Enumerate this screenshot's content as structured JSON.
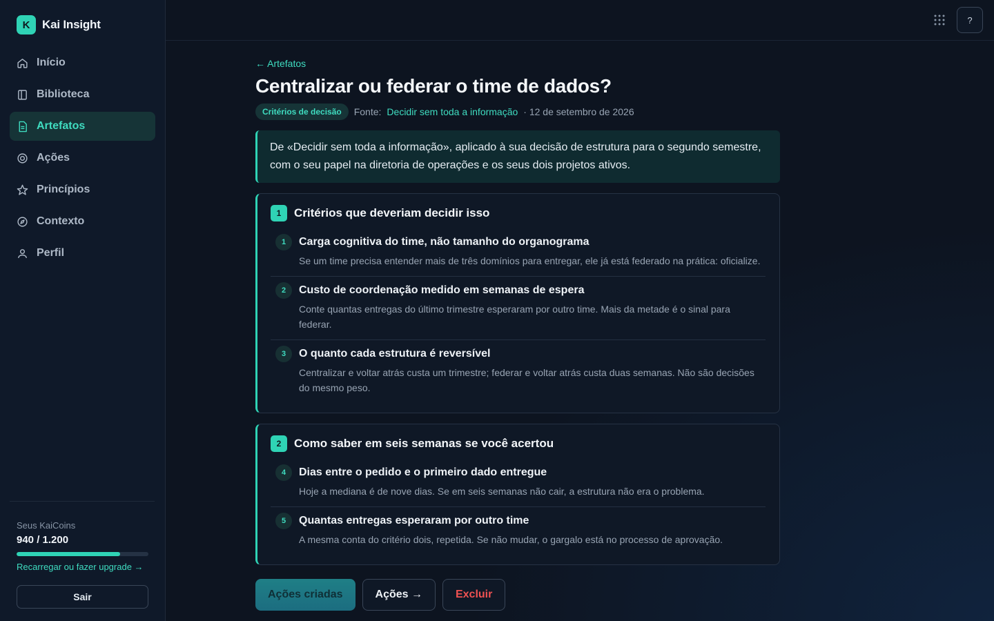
{
  "brand": {
    "logo_letter": "K",
    "name": "Kai Insight"
  },
  "sidebar": {
    "items": [
      {
        "label": "Início",
        "icon": "home-icon"
      },
      {
        "label": "Biblioteca",
        "icon": "book-icon"
      },
      {
        "label": "Artefatos",
        "icon": "document-icon",
        "active": true
      },
      {
        "label": "Ações",
        "icon": "target-icon"
      },
      {
        "label": "Princípios",
        "icon": "star-icon"
      },
      {
        "label": "Contexto",
        "icon": "compass-icon"
      },
      {
        "label": "Perfil",
        "icon": "user-icon"
      }
    ],
    "coins_label": "Seus KaiCoins",
    "coins_value": "940 / 1.200",
    "coins_progress": 0.783,
    "coins_link": "Recarregar ou fazer upgrade →",
    "logout_label": "Sair"
  },
  "topbar": {
    "help_label": "?"
  },
  "page": {
    "back_link": "← Artefatos",
    "title": "Centralizar ou federar o time de dados?",
    "tag": "Critérios de decisão",
    "source_prefix": "Fonte:",
    "source_link": "Decidir sem toda a informação",
    "date": "· 12 de setembro de 2026",
    "intro": "De «Decidir sem toda a informação», aplicado à sua decisão de estrutura para o segundo semestre, com o seu papel na diretoria de operações e os seus dois projetos ativos."
  },
  "sections": [
    {
      "num": "1",
      "title": "Critérios que deveriam decidir isso",
      "items": [
        {
          "num": "1",
          "title": "Carga cognitiva do time, não tamanho do organograma",
          "desc": "Se um time precisa entender mais de três domínios para entregar, ele já está federado na prática: oficialize."
        },
        {
          "num": "2",
          "title": "Custo de coordenação medido em semanas de espera",
          "desc": "Conte quantas entregas do último trimestre esperaram por outro time. Mais da metade é o sinal para federar."
        },
        {
          "num": "3",
          "title": "O quanto cada estrutura é reversível",
          "desc": "Centralizar e voltar atrás custa um trimestre; federar e voltar atrás custa duas semanas. Não são decisões do mesmo peso."
        }
      ]
    },
    {
      "num": "2",
      "title": "Como saber em seis semanas se você acertou",
      "items": [
        {
          "num": "4",
          "title": "Dias entre o pedido e o primeiro dado entregue",
          "desc": "Hoje a mediana é de nove dias. Se em seis semanas não cair, a estrutura não era o problema."
        },
        {
          "num": "5",
          "title": "Quantas entregas esperaram por outro time",
          "desc": "A mesma conta do critério dois, repetida. Se não mudar, o gargalo está no processo de aprovação."
        }
      ]
    }
  ],
  "actions": {
    "created": "Ações criadas",
    "actions": "Ações →",
    "delete": "Excluir"
  },
  "colors": {
    "accent": "#2fd3b5",
    "danger": "#f05252",
    "background": "#0d1420"
  }
}
